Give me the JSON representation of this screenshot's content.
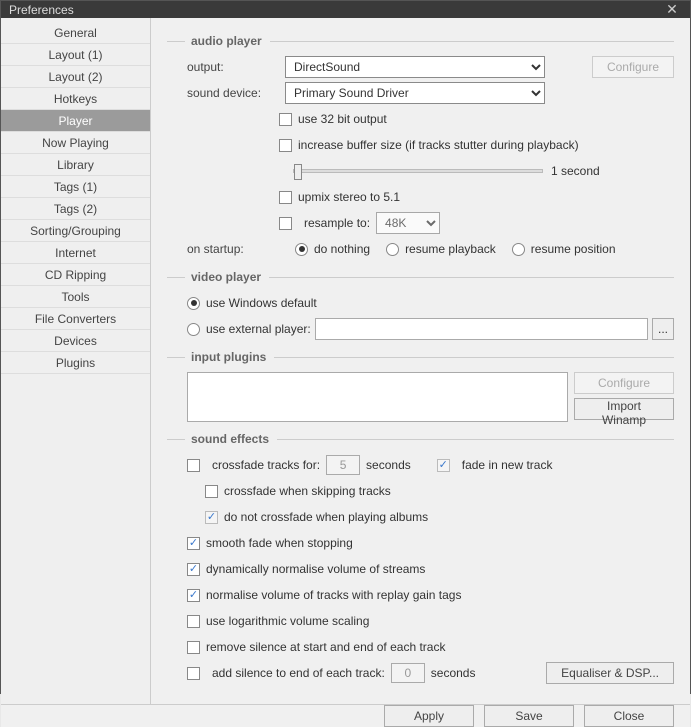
{
  "window": {
    "title": "Preferences"
  },
  "sidebar": {
    "items": [
      {
        "label": "General"
      },
      {
        "label": "Layout (1)"
      },
      {
        "label": "Layout (2)"
      },
      {
        "label": "Hotkeys"
      },
      {
        "label": "Player",
        "selected": true
      },
      {
        "label": "Now Playing"
      },
      {
        "label": "Library"
      },
      {
        "label": "Tags (1)"
      },
      {
        "label": "Tags (2)"
      },
      {
        "label": "Sorting/Grouping"
      },
      {
        "label": "Internet"
      },
      {
        "label": "CD Ripping"
      },
      {
        "label": "Tools"
      },
      {
        "label": "File Converters"
      },
      {
        "label": "Devices"
      },
      {
        "label": "Plugins"
      }
    ]
  },
  "audio": {
    "heading": "audio player",
    "output_label": "output:",
    "output_value": "DirectSound",
    "configure": "Configure",
    "sound_device_label": "sound device:",
    "sound_device_value": "Primary Sound Driver",
    "use32": "use 32 bit output",
    "increase_buffer": "increase buffer size (if tracks stutter during playback)",
    "buffer_value": "1 second",
    "upmix": "upmix stereo to 5.1",
    "resample": "resample to:",
    "resample_value": "48K",
    "startup_label": "on startup:",
    "startup_nothing": "do nothing",
    "startup_resume_pb": "resume playback",
    "startup_resume_pos": "resume position"
  },
  "video": {
    "heading": "video player",
    "use_default": "use Windows default",
    "use_external": "use external player:",
    "browse": "..."
  },
  "plugins": {
    "heading": "input plugins",
    "configure": "Configure",
    "import": "Import Winamp"
  },
  "fx": {
    "heading": "sound effects",
    "crossfade_for": "crossfade tracks for:",
    "crossfade_val": "5",
    "seconds": "seconds",
    "fade_in": "fade in new track",
    "crossfade_skip": "crossfade when skipping tracks",
    "no_crossfade_albums": "do not crossfade when playing albums",
    "smooth_fade": "smooth fade when stopping",
    "dyn_norm": "dynamically normalise volume of streams",
    "rg_norm": "normalise volume of tracks with replay gain tags",
    "log_scale": "use logarithmic volume scaling",
    "remove_silence": "remove silence at start and end of each track",
    "add_silence": "add silence to end of each track:",
    "add_silence_val": "0",
    "eq": "Equaliser & DSP..."
  },
  "footer": {
    "apply": "Apply",
    "save": "Save",
    "close": "Close"
  }
}
